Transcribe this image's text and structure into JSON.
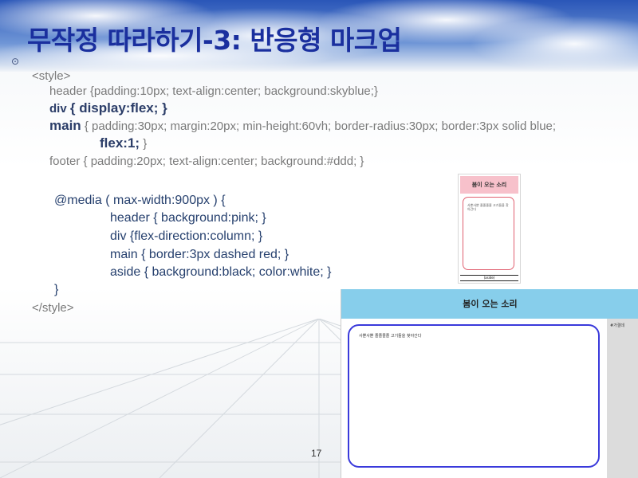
{
  "slide": {
    "title": "무작정 따라하기-3: 반응형 마크업",
    "bullet_icon": "circle-dot-icon",
    "page_number": "17"
  },
  "code": {
    "style_open": "<style>",
    "header_rule": "header {padding:10px; text-align:center; background:skyblue;}",
    "div_selector": "div",
    "div_rule": "{ display:flex; }",
    "main_selector": "main",
    "main_rule": "{ padding:30px; margin:20px; min-height:60vh; border-radius:30px;  border:3px solid blue;",
    "main_flex": "flex:1;",
    "main_close": "}",
    "footer_rule": "footer { padding:20px; text-align:center; background:#ddd; }",
    "media_open": "@media ( max-width:900px )  {",
    "media_header": "header { background:pink; }",
    "media_div": "div  {flex-direction:column; }",
    "media_main": "main { border:3px dashed red; }",
    "media_aside": "aside { background:black; color:white; }",
    "media_close": "}",
    "style_close": "</style>"
  },
  "mobile_preview": {
    "header": "봄이 오는 소리",
    "main_text": "사뿐사뿐 졸졸졸졸 고기들을 찾아간다",
    "aside": "(aside)",
    "colors": {
      "header_bg": "#f7c1cb",
      "main_border": "#e06070"
    }
  },
  "desktop_preview": {
    "header": "봄이 오는 소리",
    "main_text": "사뿐사뿐 졸졸졸졸 고기들을 찾아간다",
    "aside": "#가결데",
    "colors": {
      "header_bg": "#87ceeb",
      "main_border": "#3a3adb",
      "aside_bg": "#dcdcdc"
    }
  }
}
